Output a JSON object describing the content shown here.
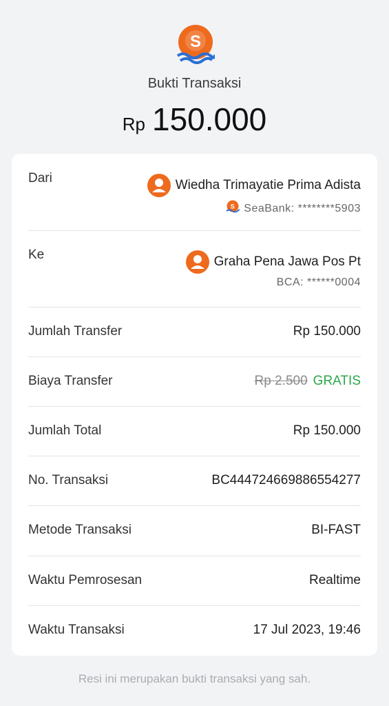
{
  "header": {
    "title": "Bukti Transaksi",
    "currency": "Rp",
    "amount": "150.000"
  },
  "from": {
    "label": "Dari",
    "name": "Wiedha Trimayatie Prima Adista",
    "account": "SeaBank: ********5903"
  },
  "to": {
    "label": "Ke",
    "name": "Graha Pena Jawa Pos Pt",
    "account": "BCA: ******0004"
  },
  "details": {
    "jumlah_transfer": {
      "label": "Jumlah Transfer",
      "value": "Rp 150.000"
    },
    "biaya_transfer": {
      "label": "Biaya Transfer",
      "original": "Rp 2.500",
      "value": "GRATIS"
    },
    "jumlah_total": {
      "label": "Jumlah Total",
      "value": "Rp 150.000"
    },
    "no_transaksi": {
      "label": "No. Transaksi",
      "value": "BC444724669886554277"
    },
    "metode": {
      "label": "Metode Transaksi",
      "value": "BI-FAST"
    },
    "waktu_proses": {
      "label": "Waktu Pemrosesan",
      "value": "Realtime"
    },
    "waktu_transaksi": {
      "label": "Waktu Transaksi",
      "value": "17 Jul 2023, 19:46"
    }
  },
  "footer": "Resi ini merupakan bukti transaksi yang sah.",
  "colors": {
    "brand": "#ee6a1d",
    "brand_blue": "#2a6fd6",
    "free": "#2aa84a"
  },
  "icons": [
    "seabank-logo-icon",
    "user-avatar-icon"
  ]
}
